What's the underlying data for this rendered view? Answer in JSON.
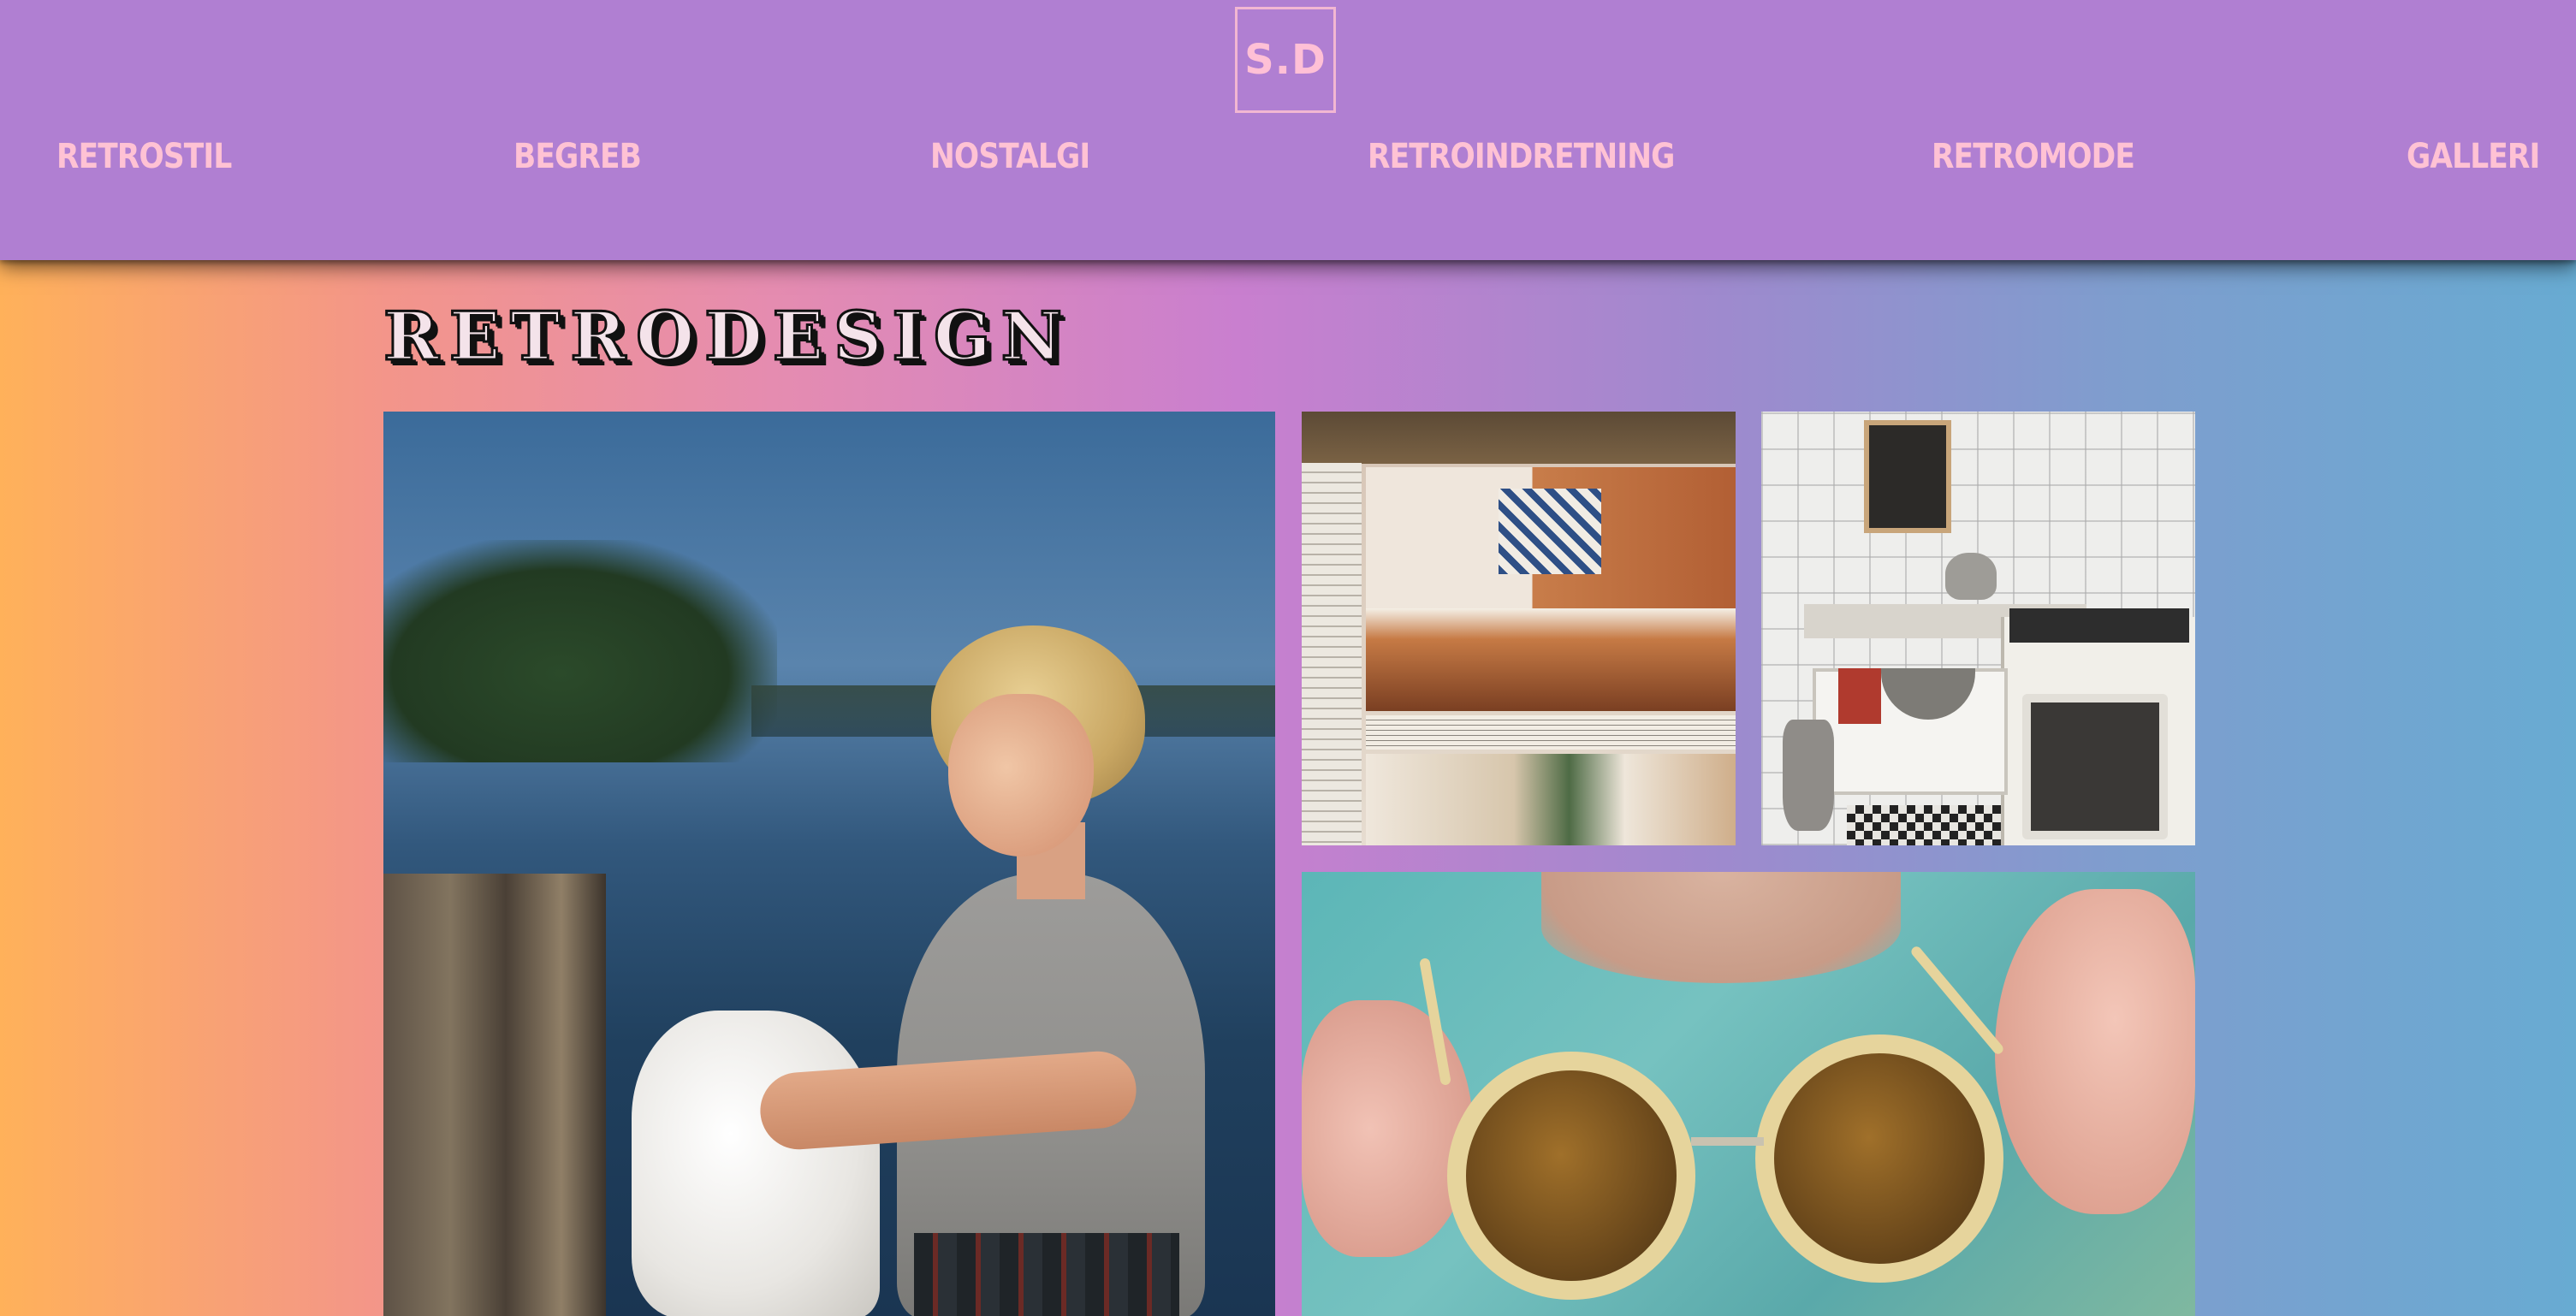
{
  "header": {
    "logo": "S.D",
    "nav": [
      "RETROSTIL",
      "BEGREB",
      "NOSTALGI",
      "RETROINDRETNING",
      "RETROMODE",
      "GALLERI"
    ]
  },
  "page": {
    "title": "RETRODESIGN"
  },
  "gallery": [
    {
      "name": "woman-by-lake-photo"
    },
    {
      "name": "vintage-magazine-kitchen-photo"
    },
    {
      "name": "white-tiled-kitchen-photo"
    },
    {
      "name": "round-sunglasses-photo"
    }
  ],
  "colors": {
    "header_bg": "#b07fd2",
    "nav_text": "#ffc2d4",
    "gradient_left": "#ffb15a",
    "gradient_middle": "#c97fcf",
    "gradient_right": "#68abd2"
  }
}
